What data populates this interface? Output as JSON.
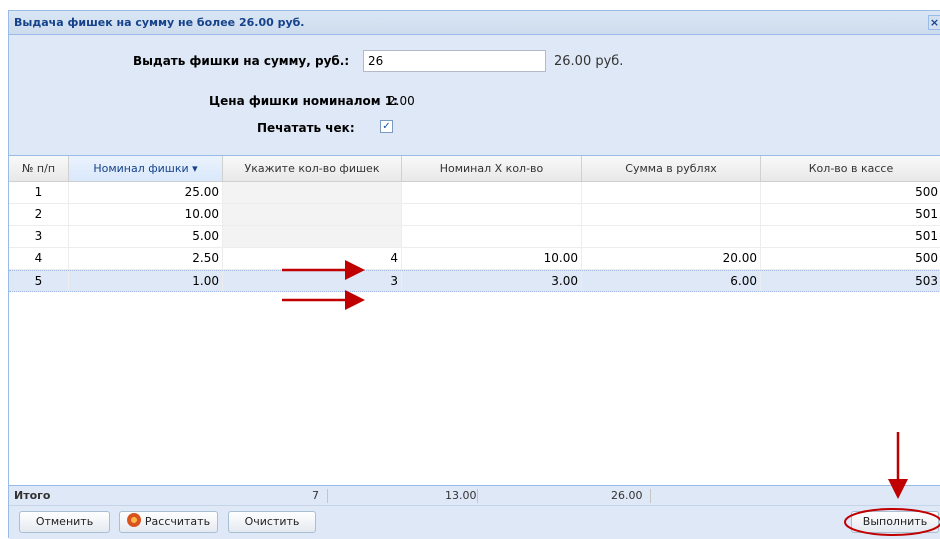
{
  "window": {
    "title": "Выдача фишек на сумму не более 26.00 руб.",
    "close_glyph": "×"
  },
  "form": {
    "sum_label": "Выдать фишки на сумму, руб.:",
    "sum_value": "26",
    "sum_display": "26.00 руб.",
    "price_label": "Цена фишки номиналом 1:",
    "price_value": "2.00",
    "print_label": "Печатать чек:",
    "print_checked": true,
    "check_glyph": "✓"
  },
  "grid": {
    "columns": [
      "№ п/п",
      "Номинал фишки ▾",
      "Укажите кол-во фишек",
      "Номинал X кол-во",
      "Сумма в рублях",
      "Кол-во в кассе"
    ],
    "sorted_column": 1,
    "rows": [
      {
        "n": "1",
        "nominal": "25.00",
        "qty": "",
        "product": "",
        "sum": "",
        "stock": "500"
      },
      {
        "n": "2",
        "nominal": "10.00",
        "qty": "",
        "product": "",
        "sum": "",
        "stock": "501"
      },
      {
        "n": "3",
        "nominal": "5.00",
        "qty": "",
        "product": "",
        "sum": "",
        "stock": "501"
      },
      {
        "n": "4",
        "nominal": "2.50",
        "qty": "4",
        "product": "10.00",
        "sum": "20.00",
        "stock": "500"
      },
      {
        "n": "5",
        "nominal": "1.00",
        "qty": "3",
        "product": "3.00",
        "sum": "6.00",
        "stock": "503"
      }
    ],
    "selected_row": 4
  },
  "totals": {
    "label": "Итого",
    "qty": "7",
    "product": "13.00",
    "sum": "26.00"
  },
  "toolbar": {
    "cancel": "Отменить",
    "calculate": "Рассчитать",
    "clear": "Очистить",
    "execute": "Выполнить"
  },
  "colors": {
    "annotation": "#c00000",
    "window_bg": "#dfe8f6",
    "title_text": "#15428b"
  }
}
